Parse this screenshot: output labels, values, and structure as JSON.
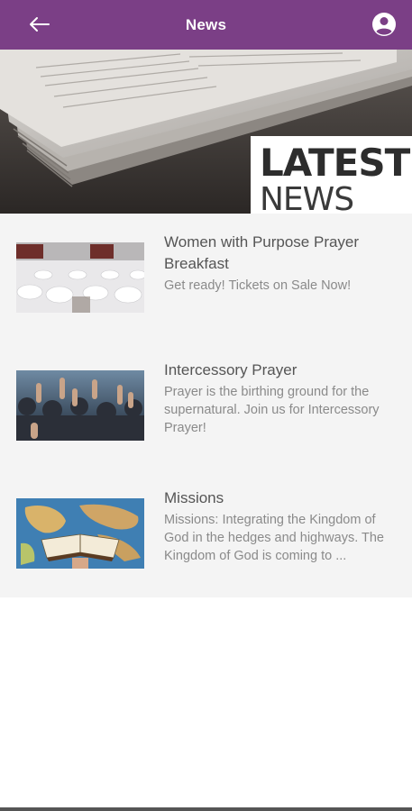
{
  "header": {
    "title": "News",
    "back_icon": "arrow-left-icon",
    "profile_icon": "account-circle-icon",
    "color": "#7b3f86"
  },
  "hero": {
    "line1": "LATEST",
    "line2": "NEWS"
  },
  "news": [
    {
      "title": "Women with Purpose Prayer Breakfast",
      "description": "Get ready! Tickets on Sale Now!"
    },
    {
      "title": "Intercessory Prayer",
      "description": "Prayer is the birthing ground for the supernatural.  Join us for Intercessory Prayer!"
    },
    {
      "title": "Missions",
      "description": "Missions: Integrating the Kingdom of God in the hedges and highways. The Kingdom of God is coming to ..."
    }
  ]
}
